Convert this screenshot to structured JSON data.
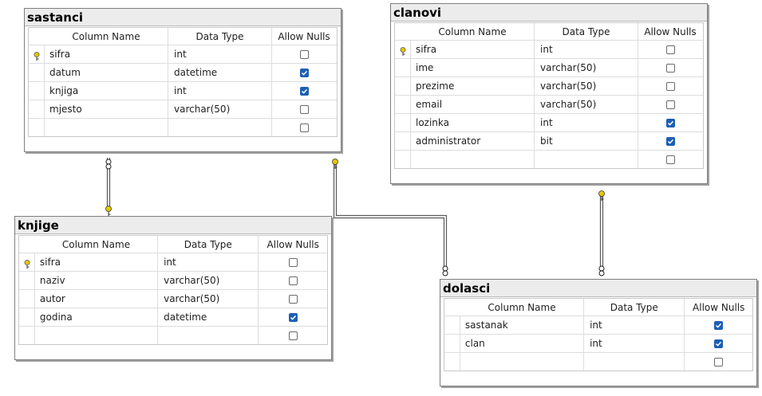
{
  "column_headers": {
    "name": "Column Name",
    "type": "Data Type",
    "nulls": "Allow Nulls"
  },
  "tables": {
    "sastanci": {
      "title": "sastanci",
      "rows": [
        {
          "name": "sifra",
          "type": "int",
          "nulls": false,
          "pk": true
        },
        {
          "name": "datum",
          "type": "datetime",
          "nulls": true,
          "pk": false
        },
        {
          "name": "knjiga",
          "type": "int",
          "nulls": true,
          "pk": false
        },
        {
          "name": "mjesto",
          "type": "varchar(50)",
          "nulls": false,
          "pk": false
        }
      ]
    },
    "clanovi": {
      "title": "clanovi",
      "rows": [
        {
          "name": "sifra",
          "type": "int",
          "nulls": false,
          "pk": true
        },
        {
          "name": "ime",
          "type": "varchar(50)",
          "nulls": false,
          "pk": false
        },
        {
          "name": "prezime",
          "type": "varchar(50)",
          "nulls": false,
          "pk": false
        },
        {
          "name": "email",
          "type": "varchar(50)",
          "nulls": false,
          "pk": false
        },
        {
          "name": "lozinka",
          "type": "int",
          "nulls": true,
          "pk": false
        },
        {
          "name": "administrator",
          "type": "bit",
          "nulls": true,
          "pk": false
        }
      ]
    },
    "knjige": {
      "title": "knjige",
      "rows": [
        {
          "name": "sifra",
          "type": "int",
          "nulls": false,
          "pk": true
        },
        {
          "name": "naziv",
          "type": "varchar(50)",
          "nulls": false,
          "pk": false
        },
        {
          "name": "autor",
          "type": "varchar(50)",
          "nulls": false,
          "pk": false
        },
        {
          "name": "godina",
          "type": "datetime",
          "nulls": true,
          "pk": false
        }
      ]
    },
    "dolasci": {
      "title": "dolasci",
      "rows": [
        {
          "name": "sastanak",
          "type": "int",
          "nulls": true,
          "pk": false
        },
        {
          "name": "clan",
          "type": "int",
          "nulls": true,
          "pk": false
        }
      ]
    }
  },
  "colors": {
    "checkbox_checked": "#1d5fb4",
    "key_icon": "#e6c700",
    "connector": "#5a5a5a"
  },
  "icons": {
    "primary_key": "key-icon",
    "relationship_one": "key-icon",
    "relationship_many": "infinity-icon"
  }
}
